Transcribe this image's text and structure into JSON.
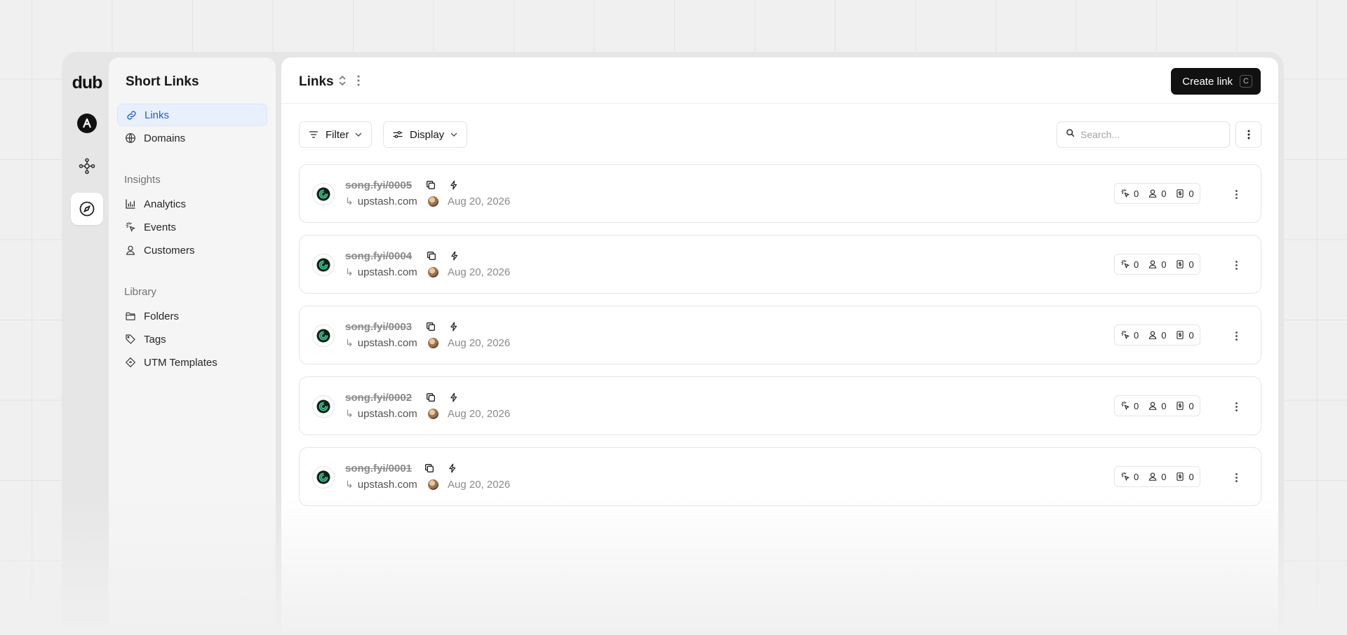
{
  "rail": {
    "logo": "dub",
    "items": [
      "workspace-avatar-icon",
      "hub-icon",
      "compass-icon"
    ]
  },
  "sidebar": {
    "title": "Short Links",
    "items": [
      {
        "label": "Links",
        "icon": "link-icon",
        "active": true
      },
      {
        "label": "Domains",
        "icon": "globe-icon"
      }
    ],
    "insights_label": "Insights",
    "insights": [
      {
        "label": "Analytics",
        "icon": "chart-icon"
      },
      {
        "label": "Events",
        "icon": "cursor-rays-icon"
      },
      {
        "label": "Customers",
        "icon": "user-icon"
      }
    ],
    "library_label": "Library",
    "library": [
      {
        "label": "Folders",
        "icon": "folder-icon"
      },
      {
        "label": "Tags",
        "icon": "tag-icon"
      },
      {
        "label": "UTM Templates",
        "icon": "diamond-icon"
      }
    ]
  },
  "header": {
    "title": "Links",
    "create_label": "Create link",
    "create_shortcut": "C"
  },
  "toolbar": {
    "filter_label": "Filter",
    "display_label": "Display",
    "search_placeholder": "Search..."
  },
  "links": [
    {
      "short": "song.fyi/0005",
      "destination": "upstash.com",
      "date": "Aug 20, 2026",
      "clicks": "0",
      "leads": "0",
      "sales": "0"
    },
    {
      "short": "song.fyi/0004",
      "destination": "upstash.com",
      "date": "Aug 20, 2026",
      "clicks": "0",
      "leads": "0",
      "sales": "0"
    },
    {
      "short": "song.fyi/0003",
      "destination": "upstash.com",
      "date": "Aug 20, 2026",
      "clicks": "0",
      "leads": "0",
      "sales": "0"
    },
    {
      "short": "song.fyi/0002",
      "destination": "upstash.com",
      "date": "Aug 20, 2026",
      "clicks": "0",
      "leads": "0",
      "sales": "0"
    },
    {
      "short": "song.fyi/0001",
      "destination": "upstash.com",
      "date": "Aug 20, 2026",
      "clicks": "0",
      "leads": "0",
      "sales": "0"
    }
  ],
  "colors": {
    "accent": "#2559d6",
    "active_bg": "#e8f0fe",
    "button": "#111111"
  }
}
